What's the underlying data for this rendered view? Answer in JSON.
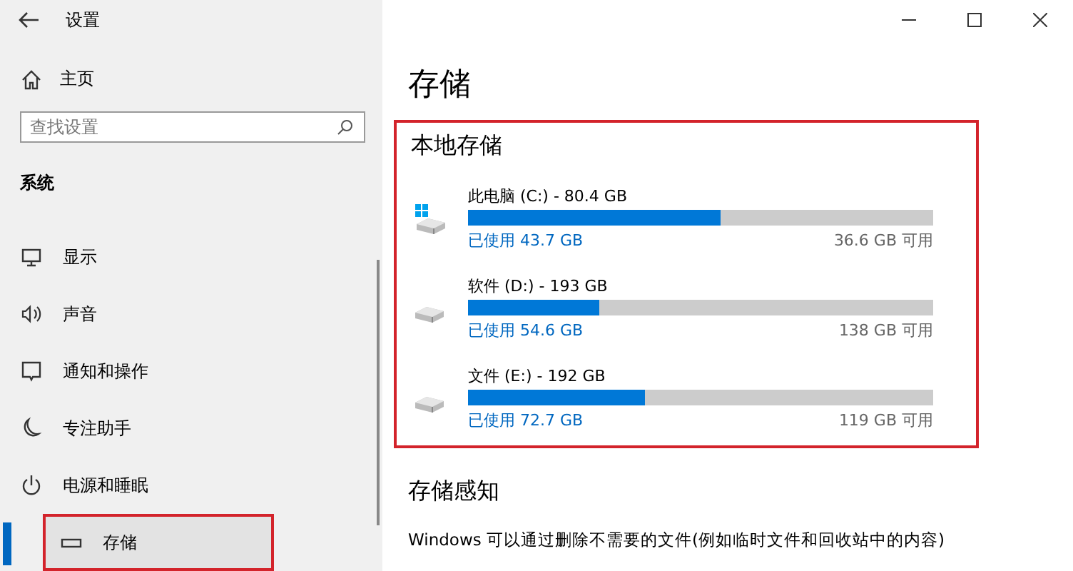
{
  "window": {
    "title": "设置"
  },
  "sidebar": {
    "home": "主页",
    "search": {
      "placeholder": "查找设置"
    },
    "section": "系统",
    "items": [
      {
        "label": "显示",
        "kind": "display",
        "selected": false,
        "highlighted": false
      },
      {
        "label": "声音",
        "kind": "sound",
        "selected": false,
        "highlighted": false
      },
      {
        "label": "通知和操作",
        "kind": "notification",
        "selected": false,
        "highlighted": false
      },
      {
        "label": "专注助手",
        "kind": "moon",
        "selected": false,
        "highlighted": false
      },
      {
        "label": "电源和睡眠",
        "kind": "power",
        "selected": false,
        "highlighted": false
      },
      {
        "label": "存储",
        "kind": "storage",
        "selected": true,
        "highlighted": true
      }
    ]
  },
  "main": {
    "title": "存储",
    "local_storage": {
      "heading": "本地存储",
      "highlighted": true,
      "drives": [
        {
          "kind": "system",
          "name": "此电脑 (C:) - 80.4 GB",
          "level": 0.544,
          "used": "已使用 43.7 GB",
          "free": "36.6 GB 可用"
        },
        {
          "kind": "plain",
          "name": "软件 (D:) - 193 GB",
          "level": 0.283,
          "used": "已使用 54.6 GB",
          "free": "138 GB 可用"
        },
        {
          "kind": "plain",
          "name": "文件 (E:) - 192 GB",
          "level": 0.379,
          "used": "已使用 72.7 GB",
          "free": "119 GB 可用"
        }
      ]
    },
    "storage_sense": {
      "heading": "存储感知",
      "description": "Windows 可以通过删除不需要的文件(例如临时文件和回收站中的内容)"
    }
  }
}
